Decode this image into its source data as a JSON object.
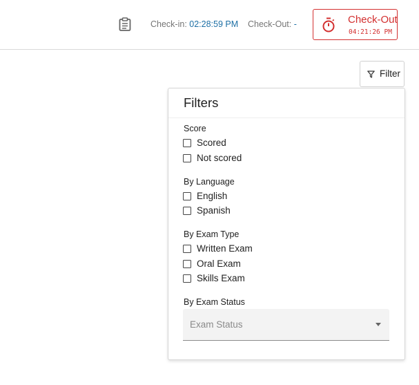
{
  "header": {
    "clipboard_icon": "clipboard-icon",
    "checkin_label": "Check-in:",
    "checkin_time": "02:28:59 PM",
    "checkout_label": "Check-Out:",
    "checkout_value": "-",
    "checkout_button": {
      "icon": "stopwatch-icon",
      "title": "Check-Out",
      "time": "04:21:26 PM",
      "color": "#d32f2f"
    },
    "accent_color": "#1d6fa5"
  },
  "filter_button": {
    "icon": "filter-funnel-icon",
    "label": "Filter"
  },
  "filters_panel": {
    "title": "Filters",
    "sections": [
      {
        "label": "Score",
        "options": [
          {
            "label": "Scored",
            "checked": false
          },
          {
            "label": "Not scored",
            "checked": false
          }
        ]
      },
      {
        "label": "By Language",
        "options": [
          {
            "label": "English",
            "checked": false
          },
          {
            "label": "Spanish",
            "checked": false
          }
        ]
      },
      {
        "label": "By Exam Type",
        "options": [
          {
            "label": "Written Exam",
            "checked": false
          },
          {
            "label": "Oral Exam",
            "checked": false
          },
          {
            "label": "Skills Exam",
            "checked": false
          }
        ]
      }
    ],
    "exam_status": {
      "label": "By Exam Status",
      "placeholder": "Exam Status",
      "icon": "chevron-down-icon"
    }
  }
}
